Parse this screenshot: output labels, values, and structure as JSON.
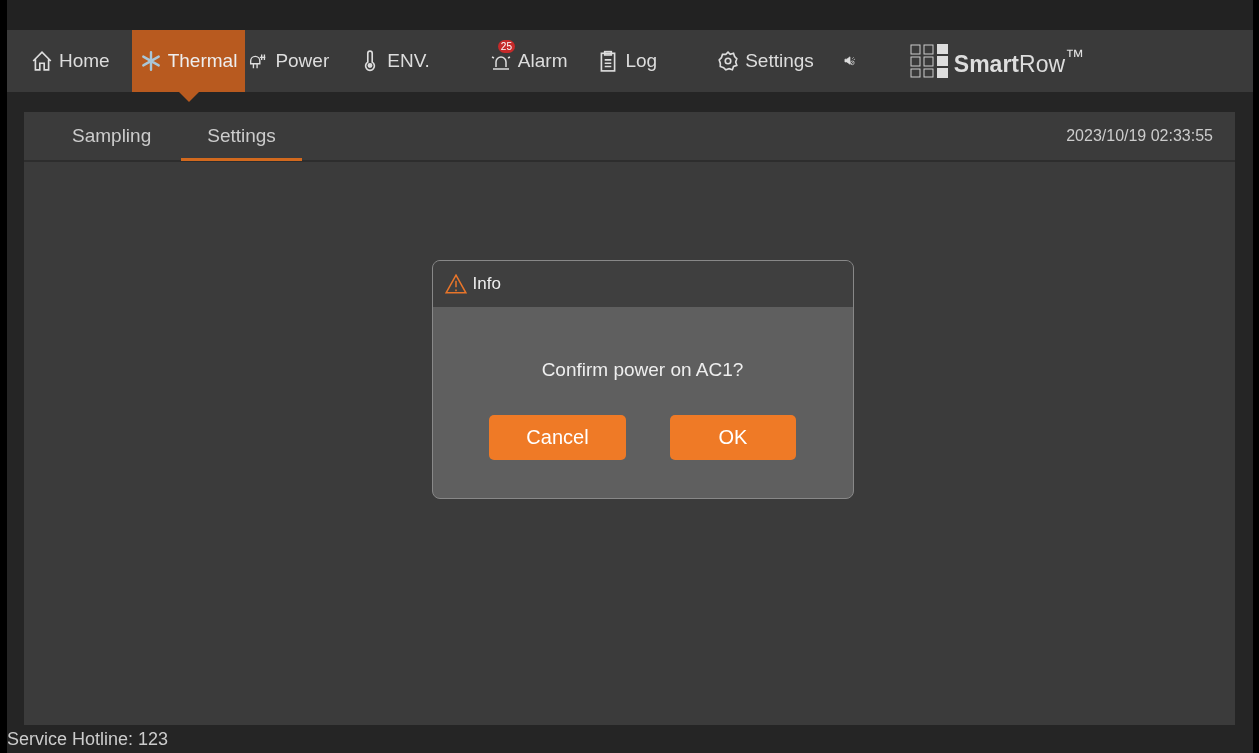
{
  "nav": [
    {
      "kind": "home",
      "label": "Home",
      "selected": false
    },
    {
      "kind": "thermal",
      "label": "Thermal",
      "selected": true
    },
    {
      "kind": "power",
      "label": "Power",
      "selected": false
    },
    {
      "kind": "env",
      "label": "ENV.",
      "selected": false
    },
    {
      "kind": "alarm",
      "label": "Alarm",
      "selected": false,
      "badge": "25"
    },
    {
      "kind": "log",
      "label": "Log",
      "selected": false
    },
    {
      "kind": "settings",
      "label": "Settings",
      "selected": false
    },
    {
      "kind": "mute",
      "selected": false
    }
  ],
  "logo": "**Smart**Row$^{™}$",
  "subtabs": [
    {
      "label": "Sampling",
      "selected": false
    },
    {
      "label": "Settings",
      "selected": true
    }
  ],
  "datetime": "2023/10/19 02:33:55",
  "dialog": {
    "title": "Info",
    "message": "Confirm power on AC1?",
    "buttons": [
      "Cancel",
      "OK"
    ]
  },
  "status_bar": "Service Hotline: 123"
}
